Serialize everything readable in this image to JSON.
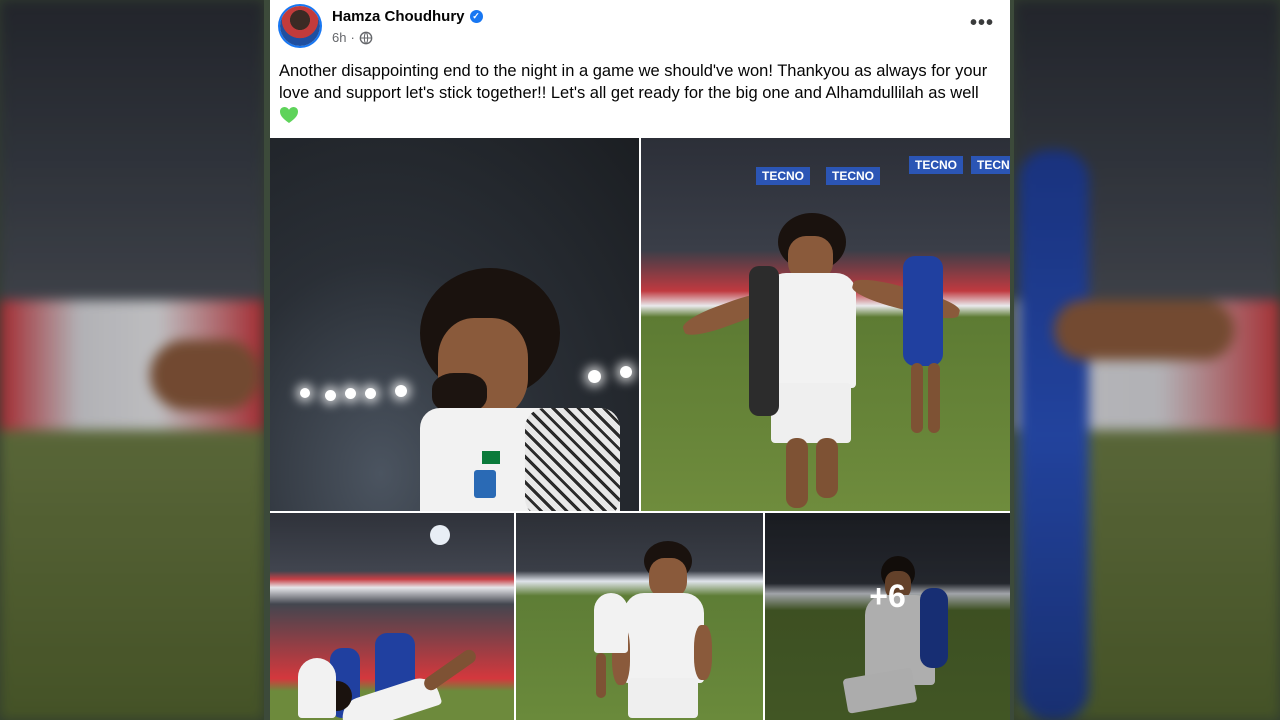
{
  "post": {
    "author": "Hamza Choudhury",
    "time": "6h",
    "separator": "·",
    "caption": "Another disappointing end to the night in a game we should've won! Thankyou as always for your love and support let's stick together!! Let's all get ready for the big one and Alhamdullilah as well",
    "more_photos_count": "+6",
    "more_options_label": "•••"
  },
  "icons": {
    "verified": "verified-badge-icon",
    "audience": "globe-icon",
    "heart": "green-heart-emoji",
    "more": "more-options-icon"
  },
  "board": {
    "sponsor_1": "TECNO",
    "sponsor_2": "TECNO",
    "sponsor_3": "TECNO",
    "sponsor_4": "TECNO"
  },
  "colors": {
    "accent": "#1877f2",
    "heart": "#5ed35a",
    "text": "#050505",
    "meta": "#65676b"
  }
}
